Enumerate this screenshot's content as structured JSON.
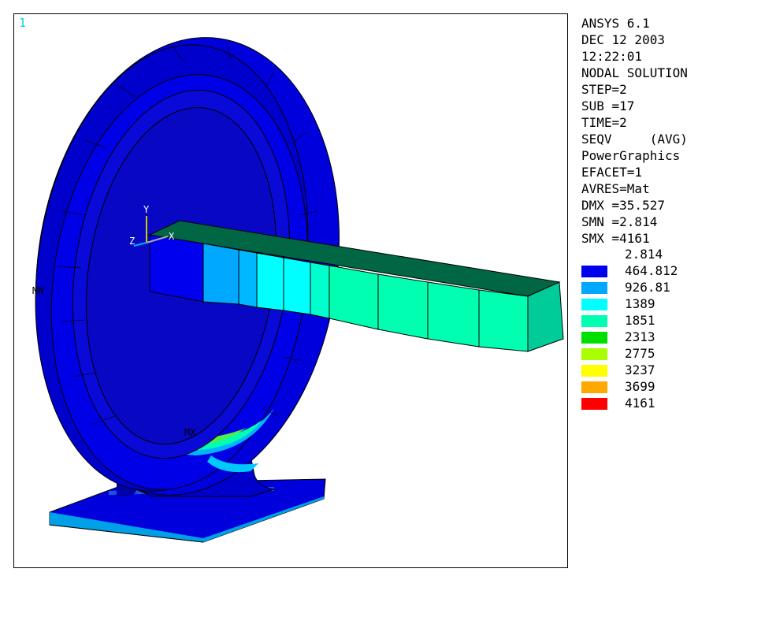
{
  "window": {
    "number": "1"
  },
  "info_lines": [
    "ANSYS 6.1",
    "DEC 12 2003",
    "12:22:01",
    "NODAL SOLUTION",
    "STEP=2",
    "SUB =17",
    "TIME=2",
    "SEQV     (AVG)",
    "PowerGraphics",
    "EFACET=1",
    "AVRES=Mat",
    "DMX =35.527",
    "SMN =2.814",
    "SMX =4161"
  ],
  "legend": {
    "min_label": "2.814",
    "entries": [
      {
        "label": "464.812",
        "color": "#0000ee"
      },
      {
        "label": "926.81",
        "color": "#00a8ff"
      },
      {
        "label": "1389",
        "color": "#00ffff"
      },
      {
        "label": "1851",
        "color": "#00ffb0"
      },
      {
        "label": "2313",
        "color": "#00e000"
      },
      {
        "label": "2775",
        "color": "#a8ff00"
      },
      {
        "label": "3237",
        "color": "#ffff00"
      },
      {
        "label": "3699",
        "color": "#ffa800"
      },
      {
        "label": "4161",
        "color": "#ff0000"
      }
    ]
  },
  "model_labels": {
    "mn": "MN",
    "mx": "MX",
    "axis_y": "Y",
    "axis_z": "Z",
    "axis_x": "X"
  }
}
